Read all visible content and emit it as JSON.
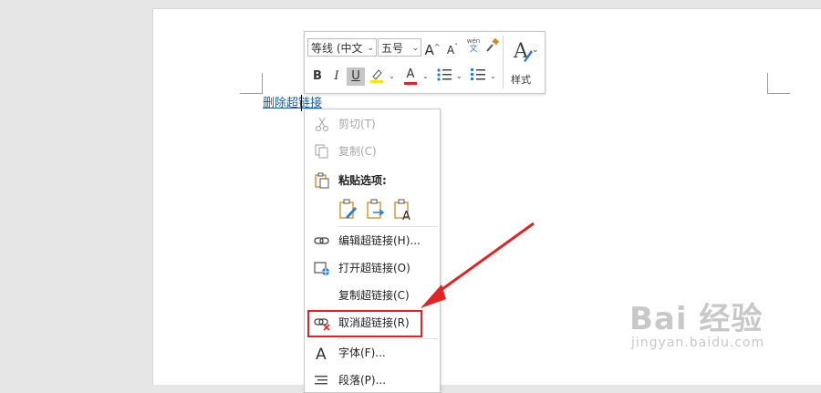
{
  "document": {
    "link_text": "删除超链接"
  },
  "mini_toolbar": {
    "font_name": "等线 (中文",
    "font_size": "五号",
    "grow_font": "A",
    "shrink_font": "A",
    "phonetic_top": "wén",
    "phonetic_bottom": "文",
    "bold": "B",
    "italic": "I",
    "underline": "U",
    "font_color": "A",
    "styles_label": "样式"
  },
  "context_menu": {
    "items": [
      {
        "label": "剪切(T)",
        "icon": "scissors-icon",
        "enabled": false
      },
      {
        "label": "复制(C)",
        "icon": "copy-icon",
        "enabled": false
      },
      {
        "label": "粘贴选项:",
        "icon": "clipboard-icon",
        "enabled": true
      },
      {
        "label": "编辑超链接(H)...",
        "icon": "link-icon",
        "enabled": true
      },
      {
        "label": "打开超链接(O)",
        "icon": "open-link-icon",
        "enabled": true
      },
      {
        "label": "复制超链接(C)",
        "icon": "",
        "enabled": true
      },
      {
        "label": "取消超链接(R)",
        "icon": "remove-link-icon",
        "enabled": true
      },
      {
        "label": "字体(F)...",
        "icon": "font-icon",
        "enabled": true
      },
      {
        "label": "段落(P)...",
        "icon": "paragraph-icon",
        "enabled": true
      }
    ],
    "paste_options": [
      "paste-keep-formatting-icon",
      "paste-merge-formatting-icon",
      "paste-text-only-icon"
    ]
  },
  "watermark": {
    "brand": "Bai 经验",
    "url": "jingyan.baidu.com"
  },
  "colors": {
    "link": "#1a5fa6",
    "highlight": "#e02424",
    "text_highlight_yellow": "#ffe600",
    "font_color_red": "#e02424",
    "accent_blue": "#2b7cd3",
    "accent_orange": "#d48a1c"
  }
}
